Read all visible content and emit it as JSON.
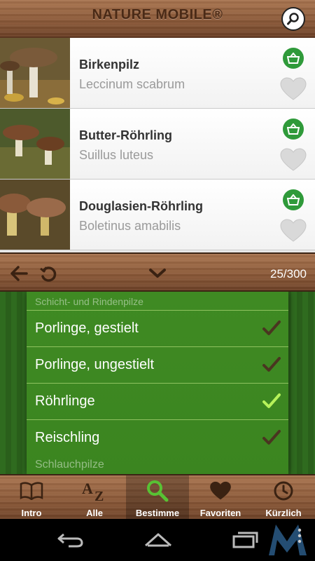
{
  "header": {
    "brand": "NATURE MOBILE®"
  },
  "species": [
    {
      "name": "Birkenpilz",
      "latin": "Leccinum scabrum"
    },
    {
      "name": "Butter-Röhrling",
      "latin": "Suillus luteus"
    },
    {
      "name": "Douglasien-Röhrling",
      "latin": "Boletinus amabilis"
    }
  ],
  "toolbar": {
    "count": "25/300"
  },
  "filters": {
    "section_top": "Schicht- und Rindenpilze",
    "items": [
      {
        "label": "Porlinge, gestielt",
        "checked": true
      },
      {
        "label": "Porlinge, ungestielt",
        "checked": true
      },
      {
        "label": "Röhrlinge",
        "checked": true,
        "highlighted": true
      },
      {
        "label": "Reischling",
        "checked": true
      }
    ],
    "section_bottom": "Schlauchpilze"
  },
  "nav": {
    "tabs": [
      {
        "label": "Intro",
        "icon": "book-icon"
      },
      {
        "label": "Alle",
        "icon": "az-sort-icon"
      },
      {
        "label": "Bestimme",
        "icon": "magnifier-icon",
        "active": true
      },
      {
        "label": "Favoriten",
        "icon": "heart-icon"
      },
      {
        "label": "Kürzlich",
        "icon": "clock-icon"
      }
    ]
  },
  "colors": {
    "accent_green": "#2f9a3a",
    "check_light": "#b6f25a",
    "check_dark": "#4a3520"
  }
}
